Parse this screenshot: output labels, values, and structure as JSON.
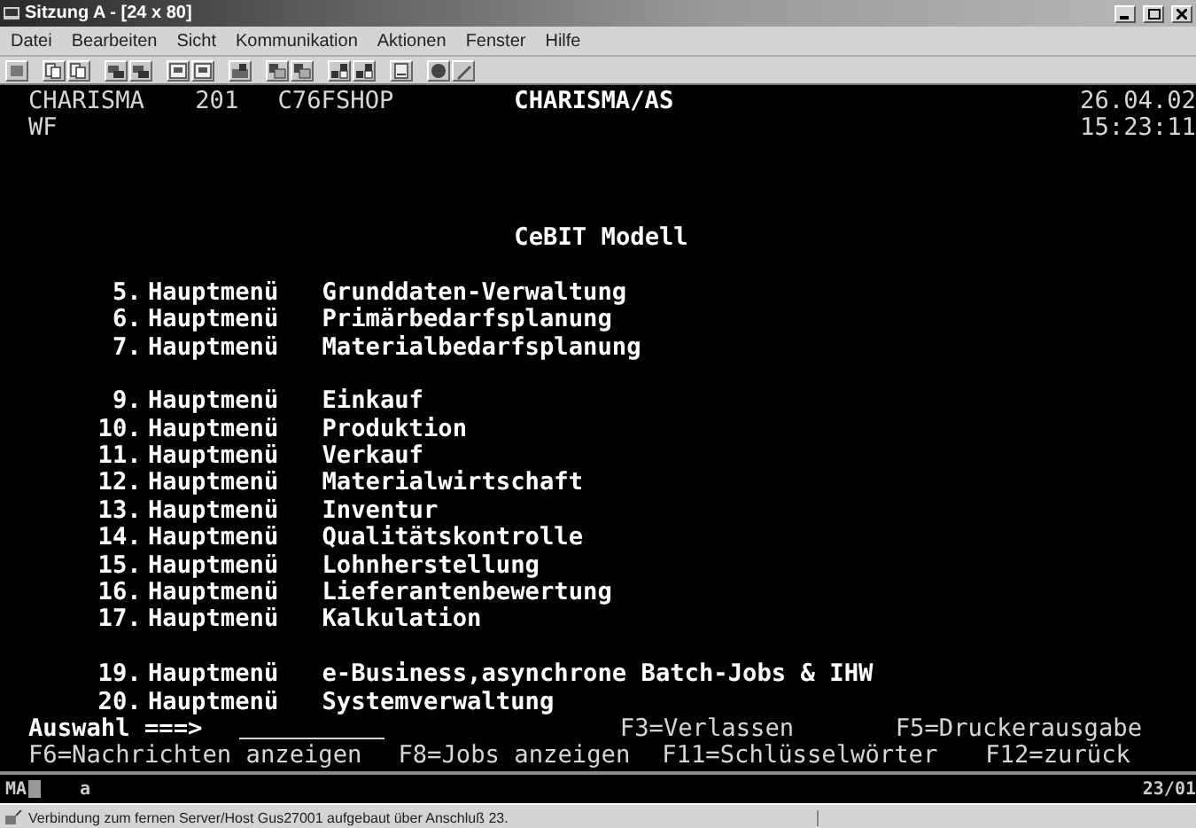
{
  "window": {
    "title": "Sitzung A - [24 x 80]"
  },
  "menu": [
    "Datei",
    "Bearbeiten",
    "Sicht",
    "Kommunikation",
    "Aktionen",
    "Fenster",
    "Hilfe"
  ],
  "terminal": {
    "header": {
      "system": "CHARISMA",
      "number": "201",
      "library": "C76FSHOP",
      "application": "CHARISMA/AS",
      "date": "26.04.02",
      "user": "WF",
      "time": "15:23:11"
    },
    "title": "CeBIT Modell",
    "groups": [
      [
        {
          "number": "5.",
          "label": "Hauptmenü",
          "description": "Grunddaten-Verwaltung"
        },
        {
          "number": "6.",
          "label": "Hauptmenü",
          "description": "Primärbedarfsplanung"
        },
        {
          "number": "7.",
          "label": "Hauptmenü",
          "description": "Materialbedarfsplanung"
        }
      ],
      [
        {
          "number": "9.",
          "label": "Hauptmenü",
          "description": "Einkauf"
        },
        {
          "number": "10.",
          "label": "Hauptmenü",
          "description": "Produktion"
        },
        {
          "number": "11.",
          "label": "Hauptmenü",
          "description": "Verkauf"
        },
        {
          "number": "12.",
          "label": "Hauptmenü",
          "description": "Materialwirtschaft"
        },
        {
          "number": "13.",
          "label": "Hauptmenü",
          "description": "Inventur"
        },
        {
          "number": "14.",
          "label": "Hauptmenü",
          "description": "Qualitätskontrolle"
        },
        {
          "number": "15.",
          "label": "Hauptmenü",
          "description": "Lohnherstellung"
        },
        {
          "number": "16.",
          "label": "Hauptmenü",
          "description": "Lieferantenbewertung"
        },
        {
          "number": "17.",
          "label": "Hauptmenü",
          "description": "Kalkulation"
        }
      ],
      [
        {
          "number": "19.",
          "label": "Hauptmenü",
          "description": "e-Business,asynchrone Batch-Jobs & IHW"
        },
        {
          "number": "20.",
          "label": "Hauptmenü",
          "description": "Systemverwaltung"
        }
      ]
    ],
    "prompt": "Auswahl ===>",
    "function_keys_row1": [
      "F3=Verlassen",
      "F5=Druckerausgabe"
    ],
    "function_keys_row2": [
      "F6=Nachrichten anzeigen",
      "F8=Jobs anzeigen",
      "F11=Schlüsselwörter",
      "F12=zurück"
    ]
  },
  "oia": {
    "mode": "MA",
    "indicator": "a",
    "position": "23/01"
  },
  "status_bar": {
    "message": "Verbindung zum fernen Server/Host Gus27001 aufgebaut über Anschluß 23."
  }
}
